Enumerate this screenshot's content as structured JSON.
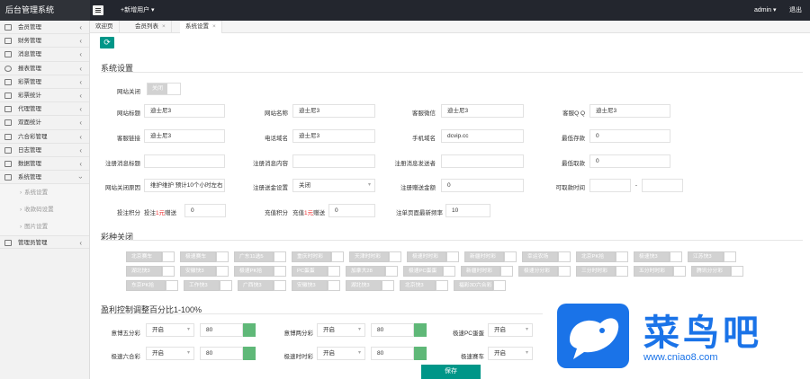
{
  "header": {
    "brand": "后台管理系统",
    "add_user": "+新增用户 ▾",
    "admin": "admin ▾",
    "logout": "退出"
  },
  "sidebar": {
    "items": [
      {
        "label": "会员管理",
        "icon": "user-icon"
      },
      {
        "label": "财务管理",
        "icon": "bank-icon"
      },
      {
        "label": "消息管理",
        "icon": "document-icon"
      },
      {
        "label": "报表管理",
        "icon": "refresh-icon"
      },
      {
        "label": "彩票管理",
        "icon": "user-icon"
      },
      {
        "label": "彩票统计",
        "icon": "user-icon"
      },
      {
        "label": "代理管理",
        "icon": "user-icon"
      },
      {
        "label": "双面统计",
        "icon": "user-icon"
      },
      {
        "label": "六合彩管理",
        "icon": "user-icon"
      },
      {
        "label": "日志管理",
        "icon": "user-icon"
      },
      {
        "label": "数据管理",
        "icon": "user-icon"
      },
      {
        "label": "系统管理",
        "icon": "user-icon"
      }
    ],
    "subitems": [
      "系统设置",
      "收款码设置",
      "图片设置"
    ],
    "last_item": {
      "label": "管理员管理",
      "icon": "user-icon"
    }
  },
  "tabs": [
    {
      "label": "欢迎页"
    },
    {
      "label": "会员列表"
    },
    {
      "label": "系统设置"
    }
  ],
  "tab_close": "×",
  "refresh_icon": "⟳",
  "settings": {
    "title": "系统设置",
    "site_close_label": "网站关闭",
    "site_close_toggle": "关闭",
    "row1": [
      {
        "label": "网站标题",
        "value": "迪士尼3"
      },
      {
        "label": "网站名称",
        "value": "迪士尼3"
      },
      {
        "label": "客服微信",
        "value": "迪士尼3"
      },
      {
        "label": "客服Q Q",
        "value": "迪士尼3"
      }
    ],
    "row2": [
      {
        "label": "客服链接",
        "value": "迪士尼3"
      },
      {
        "label": "电话域名",
        "value": "迪士尼3"
      },
      {
        "label": "手机域名",
        "value": "dcvip.cc"
      },
      {
        "label": "最低存款",
        "value": "0"
      }
    ],
    "row3": [
      {
        "label": "注册消息标题",
        "value": ""
      },
      {
        "label": "注册消息内容",
        "value": ""
      },
      {
        "label": "注册消息发送者",
        "value": ""
      },
      {
        "label": "最低取款",
        "value": "0"
      }
    ],
    "close_reason_label": "网站关闭原因",
    "close_reason_value": "维护维护 预计10个小时左右",
    "reg_amount_label": "注册送金设置",
    "reg_amount_value": "关闭",
    "reg_gift_label": "注册赠送金额",
    "reg_gift_value": "0",
    "withdraw_time_label": "可取款时间",
    "withdraw_sep": "-",
    "bet_points_label": "投注积分",
    "bet_points_a": "投注",
    "bet_points_b": "1元",
    "bet_points_c": "赠送",
    "bet_points_value": "0",
    "deposit_points_label": "充值积分",
    "deposit_points_a": "充值",
    "deposit_points_b": "1元",
    "deposit_points_c": "赠送",
    "deposit_points_value": "0",
    "refresh_rate_label": "注单页面最新频率",
    "refresh_rate_value": "10"
  },
  "lottery_close": {
    "title": "彩种关闭",
    "items": [
      "北京赛车",
      "极速赛车",
      "广东11选5",
      "重庆时时彩",
      "天津时时彩",
      "极速时时彩",
      "新疆时时彩",
      "幸运农场",
      "北京PK拾",
      "极速快3",
      "江苏快3",
      "湖北快3",
      "安徽快3",
      "极速PK拾",
      "PC蛋蛋",
      "加拿大28",
      "极速PC蛋蛋",
      "新疆时时彩",
      "极速分分彩",
      "三分时时彩",
      "五分时时彩",
      "腾讯分分彩",
      "东京PK拾",
      "工作快3",
      "广西快3",
      "安徽快3",
      "湖北快3",
      "北京快3",
      "福彩3D六合彩"
    ]
  },
  "profit": {
    "title": "盈利控制调整百分比1-100%",
    "rows": [
      [
        {
          "label": "意博五分彩",
          "select": "开启",
          "value": "80"
        },
        {
          "label": "意博两分彩",
          "select": "开启",
          "value": "80"
        },
        {
          "label": "极速PC蛋蛋",
          "select": "开启",
          "value": ""
        }
      ],
      [
        {
          "label": "极速六合彩",
          "select": "开启",
          "value": "80"
        },
        {
          "label": "极速时时彩",
          "select": "开启",
          "value": "80"
        },
        {
          "label": "极速赛车",
          "select": "开启",
          "value": ""
        }
      ]
    ]
  },
  "save_label": "保存",
  "watermark": {
    "text": "菜鸟吧",
    "url": "www.cniao8.com"
  },
  "colors": {
    "primary": "#009688",
    "topbar": "#23262e",
    "toggle_off": "#d2d2d2",
    "green_swatch": "#5fb878",
    "watermark": "#1a73e8"
  }
}
